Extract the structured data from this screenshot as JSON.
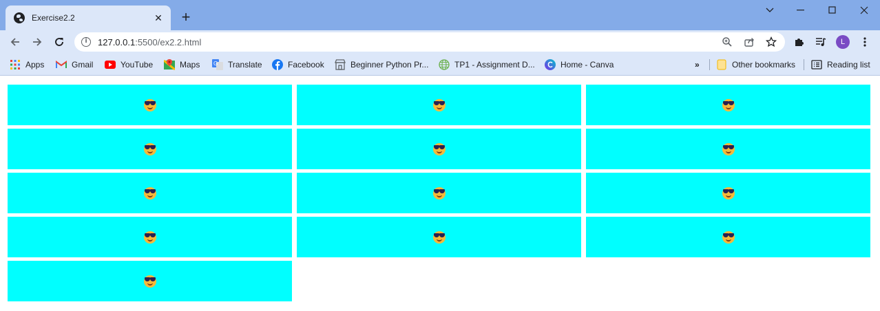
{
  "tab": {
    "title": "Exercise2.2",
    "close": "✕"
  },
  "new_tab": "+",
  "address": {
    "host": "127.0.0.1",
    "path": ":5500/ex2.2.html"
  },
  "profile": {
    "initial": "L",
    "color": "#7a4bc4"
  },
  "bookmarks": {
    "items": [
      {
        "label": "Apps",
        "icon": "apps-grid-icon"
      },
      {
        "label": "Gmail",
        "icon": "gmail-icon"
      },
      {
        "label": "YouTube",
        "icon": "youtube-icon"
      },
      {
        "label": "Maps",
        "icon": "maps-icon"
      },
      {
        "label": "Translate",
        "icon": "translate-icon"
      },
      {
        "label": "Facebook",
        "icon": "facebook-icon"
      },
      {
        "label": "Beginner Python Pr...",
        "icon": "storefront-icon"
      },
      {
        "label": "TP1 - Assignment D...",
        "icon": "globe-icon"
      },
      {
        "label": "Home - Canva",
        "icon": "canva-icon"
      }
    ],
    "overflow": "»",
    "other": "Other bookmarks",
    "reading_list": "Reading list"
  },
  "page": {
    "cell_color": "#00ffff",
    "cells": [
      {
        "emoji": "smiling-face-with-sunglasses"
      },
      {
        "emoji": "smiling-face-with-sunglasses"
      },
      {
        "emoji": "smiling-face-with-sunglasses"
      },
      {
        "emoji": "smiling-face-with-sunglasses"
      },
      {
        "emoji": "smiling-face-with-sunglasses"
      },
      {
        "emoji": "smiling-face-with-sunglasses"
      },
      {
        "emoji": "smiling-face-with-sunglasses"
      },
      {
        "emoji": "smiling-face-with-sunglasses"
      },
      {
        "emoji": "smiling-face-with-sunglasses"
      },
      {
        "emoji": "smiling-face-with-sunglasses"
      },
      {
        "emoji": "smiling-face-with-sunglasses"
      },
      {
        "emoji": "smiling-face-with-sunglasses"
      },
      {
        "emoji": "smiling-face-with-sunglasses"
      }
    ]
  }
}
